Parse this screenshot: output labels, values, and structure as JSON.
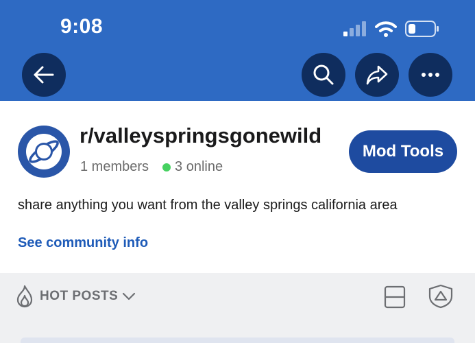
{
  "status_bar": {
    "time": "9:08"
  },
  "nav": {
    "back_icon": "arrow-left-icon",
    "search_icon": "search-icon",
    "share_icon": "share-icon",
    "more_icon": "more-icon"
  },
  "community": {
    "name": "r/valleyspringsgonewild",
    "members": "1 members",
    "online": "3 online",
    "mod_button": "Mod Tools",
    "description": "share anything you want from the valley springs california area",
    "info_link": "See community info",
    "avatar_icon": "planet-icon"
  },
  "feed": {
    "sort_label": "HOT POSTS"
  },
  "colors": {
    "header": "#2e6ac3",
    "nav_button": "#0f2d5e",
    "mod_button": "#1e4ba0",
    "online_dot": "#46d160",
    "link": "#1e5bb8"
  }
}
